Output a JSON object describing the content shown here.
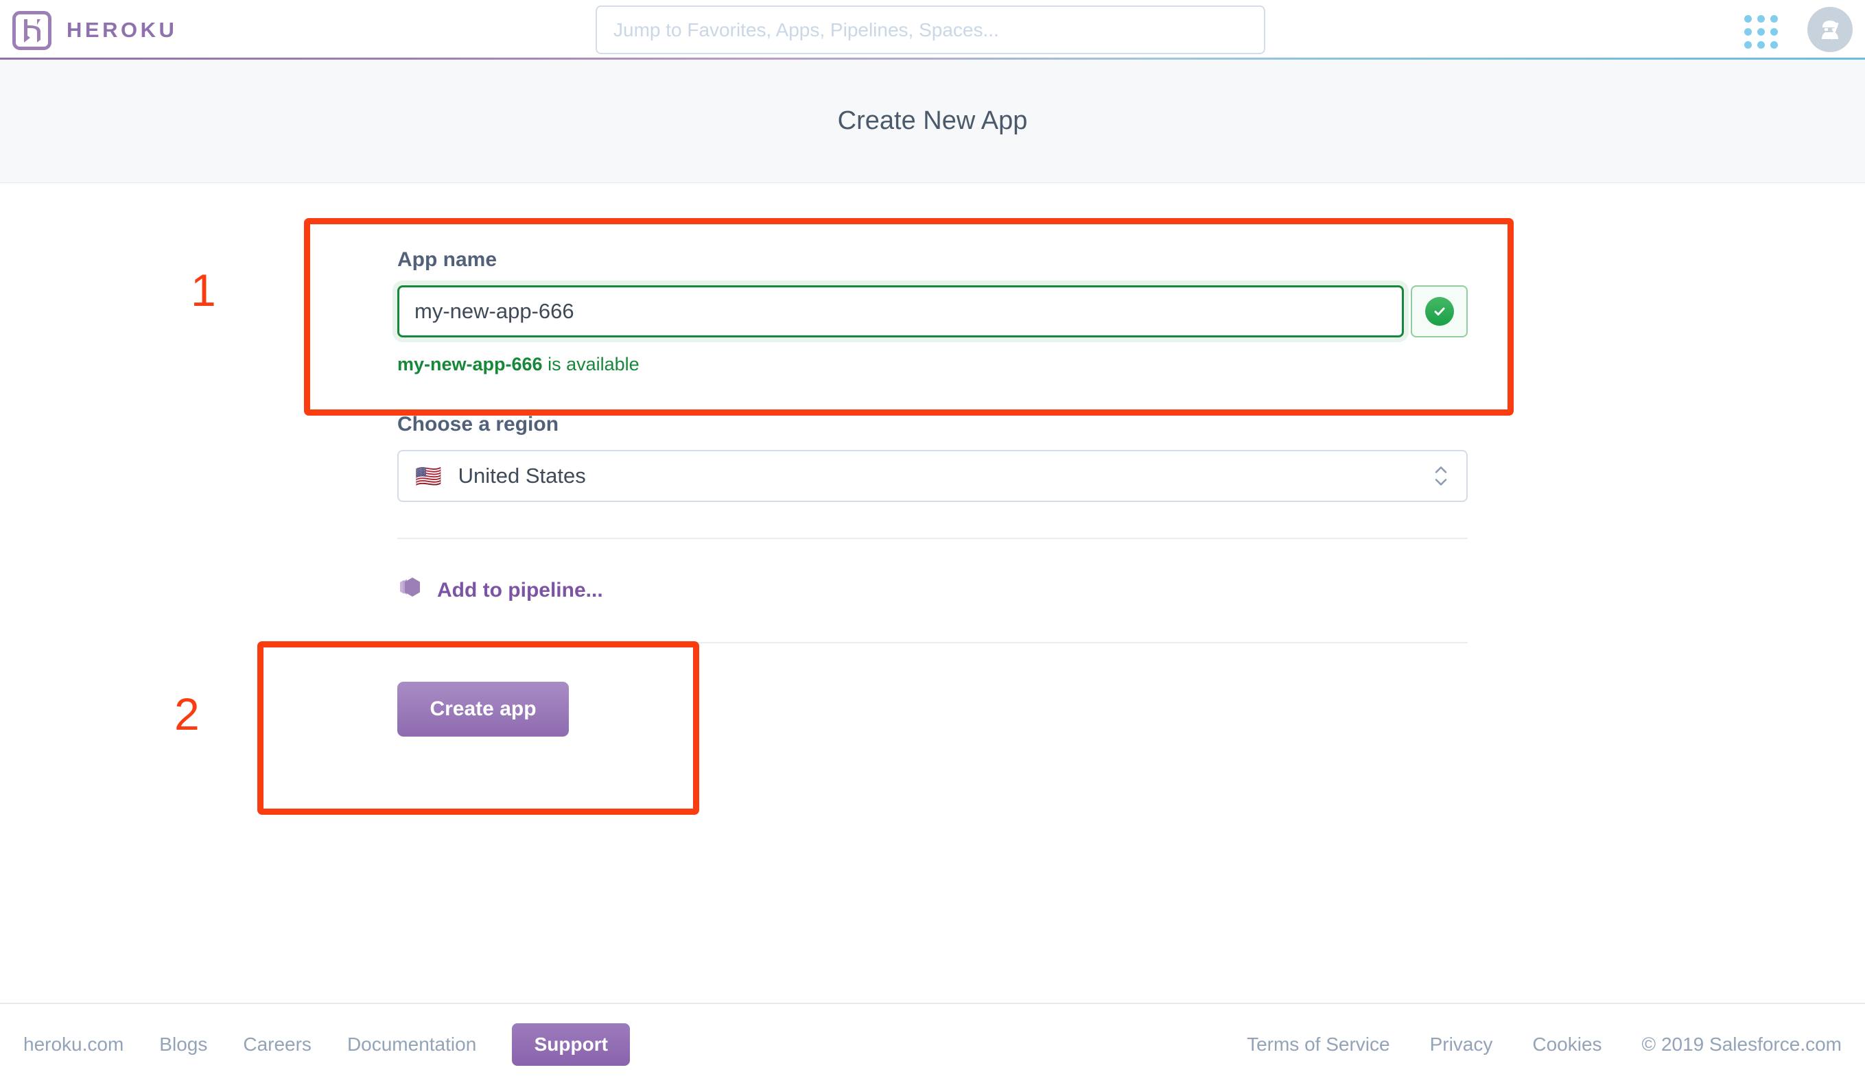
{
  "nav": {
    "brand_name": "HEROKU",
    "logo_icon": "heroku-logo-icon",
    "search_placeholder": "Jump to Favorites, Apps, Pipelines, Spaces...",
    "search_value": "",
    "app_grid_icon": "app-grid-icon",
    "avatar_icon": "ninja-avatar-icon"
  },
  "page": {
    "title": "Create New App"
  },
  "form": {
    "app_name_label": "App name",
    "app_name_value": "my-new-app-666",
    "validation_name": "my-new-app-666",
    "validation_suffix": " is available",
    "valid_icon": "check-circle-icon",
    "region_label": "Choose a region",
    "region_value": "United States",
    "region_flag": "🇺🇸",
    "region_arrow_icon": "chevron-updown-icon",
    "pipeline_link": "Add to pipeline...",
    "pipeline_icon": "pipeline-hexagon-icon",
    "create_button": "Create app"
  },
  "annotations": {
    "items": [
      {
        "number": "1",
        "target": "app-name-field"
      },
      {
        "number": "2",
        "target": "create-app-button"
      }
    ],
    "color": "#fa3c11"
  },
  "footer": {
    "left_links": [
      "heroku.com",
      "Blogs",
      "Careers",
      "Documentation"
    ],
    "support_button": "Support",
    "right_links": [
      "Terms of Service",
      "Privacy",
      "Cookies"
    ],
    "copyright": "© 2019 Salesforce.com"
  },
  "colors": {
    "brand_purple": "#8f72ad",
    "accent_green": "#17883a",
    "annotation_red": "#fa3c11",
    "text_slate": "#51617a"
  }
}
